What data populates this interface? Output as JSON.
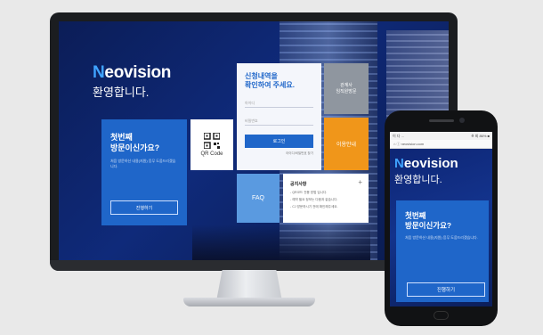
{
  "brand": {
    "prefix": "N",
    "rest": "eovision"
  },
  "desktop": {
    "welcome": "환영합니다.",
    "first_visit": {
      "title_line1": "첫번째",
      "title_line2": "방문이신가요?",
      "desc": "처음 방문하신 내용(지원) 응무 도움드리겠습니다.",
      "button": "진행하기"
    },
    "qr": {
      "label": "QR Code"
    },
    "login": {
      "title_line1": "신청내역을",
      "title_line2": "확인하여 주세요.",
      "id_placeholder": "아이디",
      "pw_placeholder": "비밀번호",
      "button": "로그인",
      "link": "아이디/비밀번호 찾기"
    },
    "tile_gray": {
      "line1": "관계사",
      "line2": "임직원방문"
    },
    "tile_orange": "이용안내",
    "faq": "FAQ",
    "notice": {
      "title": "공지사항",
      "plus": "+",
      "items": [
        "- QR코드 전용 방법 입니다.",
        "- 예약 필요 정보는 다음과 같습니다.",
        "- CJ 방문하시기 전에 확인해주세요."
      ]
    }
  },
  "mobile": {
    "status_left": "이 다 ...",
    "status_right": "※ 회 86% ■",
    "url": "⌂  ⓘ  neovision.com",
    "welcome": "환영합니다.",
    "first_visit": {
      "title_line1": "첫번째",
      "title_line2": "방문이신가요?",
      "desc": "처음 방문하신 내용(지원) 응무 도움드리겠습니다.",
      "button": "진행하기"
    }
  }
}
